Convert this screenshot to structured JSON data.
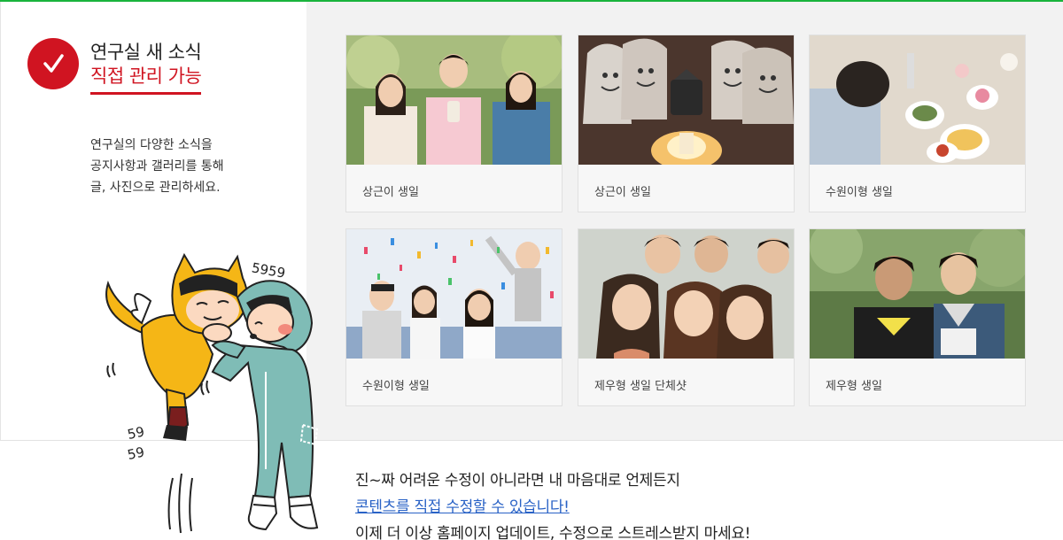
{
  "heading": {
    "line1": "연구실 새 소식",
    "line2": "직접 관리 가능"
  },
  "description": [
    "연구실의 다양한 소식을",
    "공지사항과 갤러리를 통해",
    "글, 사진으로 관리하세요."
  ],
  "gallery": [
    {
      "caption": "상근이 생일"
    },
    {
      "caption": "상근이 생일"
    },
    {
      "caption": "수원이형 생일"
    },
    {
      "caption": "수원이형 생일"
    },
    {
      "caption": "제우형 생일 단체샷"
    },
    {
      "caption": "제우형 생일"
    }
  ],
  "illustration": {
    "sound_top": "5959",
    "sound_side_1": "59",
    "sound_side_2": "59"
  },
  "bottom": {
    "line1": "진~짜 어려운 수정이 아니라면 내 마음대로 언제든지",
    "line2": "콘텐츠를 직접 수정할 수 있습니다!",
    "line3": "이제 더 이상 홈페이지 업데이트, 수정으로 스트레스받지 마세요!"
  },
  "colors": {
    "accent": "#d01421",
    "top_line": "#19b43c",
    "link": "#2962c6",
    "panel_bg": "#f2f2f2"
  }
}
